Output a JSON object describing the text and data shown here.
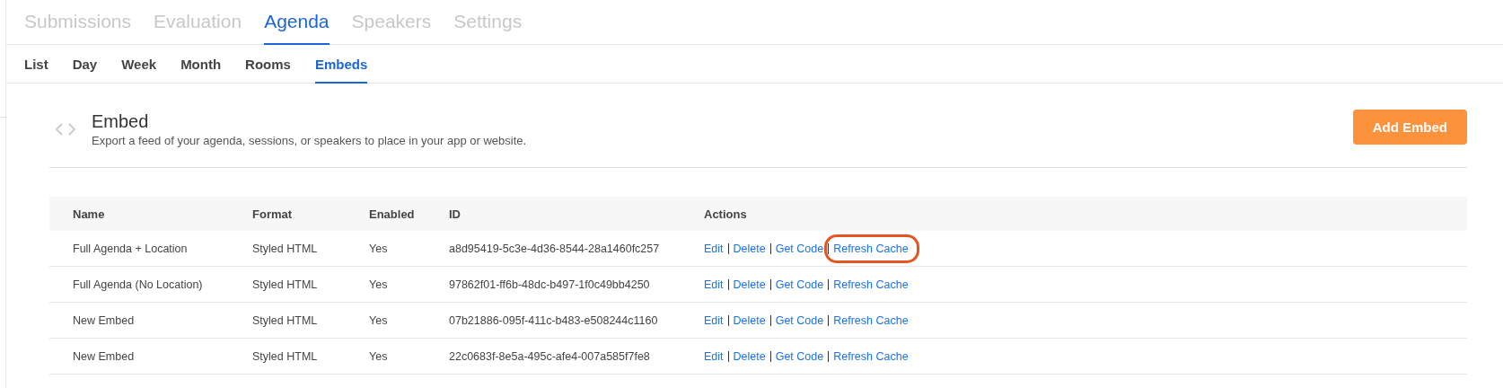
{
  "main_tabs": [
    {
      "label": "Submissions",
      "selected": false
    },
    {
      "label": "Evaluation",
      "selected": false
    },
    {
      "label": "Agenda",
      "selected": true
    },
    {
      "label": "Speakers",
      "selected": false
    },
    {
      "label": "Settings",
      "selected": false
    }
  ],
  "sub_tabs": [
    {
      "label": "List",
      "selected": false
    },
    {
      "label": "Day",
      "selected": false
    },
    {
      "label": "Week",
      "selected": false
    },
    {
      "label": "Month",
      "selected": false
    },
    {
      "label": "Rooms",
      "selected": false
    },
    {
      "label": "Embeds",
      "selected": true
    }
  ],
  "header": {
    "title": "Embed",
    "description": "Export a feed of your agenda, sessions, or speakers to place in your app or website.",
    "button": "Add Embed"
  },
  "table": {
    "columns": [
      "Name",
      "Format",
      "Enabled",
      "ID",
      "Actions"
    ],
    "rows": [
      {
        "cells": [
          "Full Agenda + Location",
          "Styled HTML",
          "Yes",
          "a8d95419-5c3e-4d36-8544-28a1460fc257"
        ],
        "actions": [
          {
            "label": "Edit",
            "circled": false
          },
          {
            "label": "Delete",
            "circled": false
          },
          {
            "label": "Get Code",
            "circled": false
          },
          {
            "label": "Refresh Cache",
            "circled": true
          }
        ]
      },
      {
        "cells": [
          "Full Agenda (No Location)",
          "Styled HTML",
          "Yes",
          "97862f01-ff6b-48dc-b497-1f0c49bb4250"
        ],
        "actions": [
          {
            "label": "Edit",
            "circled": false
          },
          {
            "label": "Delete",
            "circled": false
          },
          {
            "label": "Get Code",
            "circled": false
          },
          {
            "label": "Refresh Cache",
            "circled": false
          }
        ]
      },
      {
        "cells": [
          "New Embed",
          "Styled HTML",
          "Yes",
          "07b21886-095f-411c-b483-e508244c1160"
        ],
        "actions": [
          {
            "label": "Edit",
            "circled": false
          },
          {
            "label": "Delete",
            "circled": false
          },
          {
            "label": "Get Code",
            "circled": false
          },
          {
            "label": "Refresh Cache",
            "circled": false
          }
        ]
      },
      {
        "cells": [
          "New Embed",
          "Styled HTML",
          "Yes",
          "22c0683f-8e5a-495c-afe4-007a585f7fe8"
        ],
        "actions": [
          {
            "label": "Edit",
            "circled": false
          },
          {
            "label": "Delete",
            "circled": false
          },
          {
            "label": "Get Code",
            "circled": false
          },
          {
            "label": "Refresh Cache",
            "circled": false
          }
        ]
      }
    ]
  }
}
